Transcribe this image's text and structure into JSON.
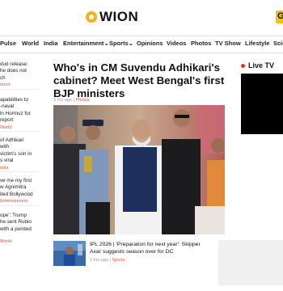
{
  "brand": {
    "name": "WION",
    "right_button": "G"
  },
  "nav": [
    "Pulse",
    "World",
    "India",
    "Entertainment",
    "Sports",
    "Opinions",
    "Videos",
    "Photos",
    "TV Show",
    "Lifestyle",
    "Scie"
  ],
  "nav_dropdown_suffix": "⌄",
  "sidebar": [
    {
      "lines": [
        "dud release:",
        "he does not",
        "ch"
      ],
      "category": "ntent"
    },
    {
      "lines": [
        "apabilities to",
        "-naval",
        "ln Hormuz for",
        "report"
      ],
      "category": "World"
    },
    {
      "lines": [
        "of Adhikari",
        "with",
        "victim's son in",
        "s viral"
      ],
      "category": "ndia"
    },
    {
      "lines": [
        "ve me my first",
        "w Agnimitra",
        "ited Bollywood"
      ],
      "category": "Entertainment"
    },
    {
      "lines": [
        "ope': Trump",
        "he sent Rubio",
        "with a pointed"
      ],
      "category": "World"
    }
  ],
  "main_story": {
    "headline": "Who's in CM Suvendu Adhikari's cabinet? Meet West Bengal's first BJP ministers",
    "time": "3 hrs ago",
    "separator": " | ",
    "category": "Photos"
  },
  "live": {
    "label": "Live TV"
  },
  "second_story": {
    "title": "IPL 2026 | 'Preparation for next year': Skipper Axar suggests season over for DC",
    "time": "2 hrs ago",
    "separator": " | ",
    "category": "Sports"
  },
  "colors": {
    "accent": "#e3563f",
    "logo": "#f3b21b",
    "live_dot": "#e0342a"
  }
}
